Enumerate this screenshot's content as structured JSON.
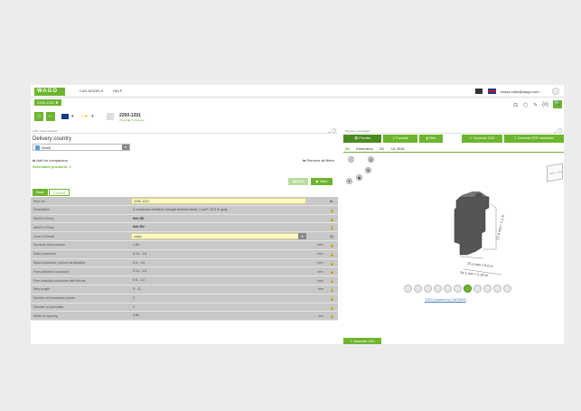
{
  "brand": {
    "logo": "WAGO",
    "accent": "#6cb52d"
  },
  "topnav": {
    "cad_models": "CAD MODELS",
    "help": "HELP",
    "user_email": "louisa.zahn@wago.com"
  },
  "open_tab": "2250-1201 ✖",
  "toolbar_icons": [
    "compare-icon",
    "cube-icon",
    "pencil-icon",
    "code-icon",
    "search-icon"
  ],
  "product": {
    "number": "2250-1201",
    "path": "WAGO ▶ Turbogene"
  },
  "left_panel": {
    "header": "CAD model selection",
    "delivery_country_title": "Delivery country",
    "country": "World",
    "add_comparison": "Add for comparison",
    "remove_filters": "Remove all filters",
    "selectable_products": "Selectable products: 1",
    "back": "◀ Back",
    "next": "▶ Next",
    "tabs": [
      "Base",
      "CLASS"
    ]
  },
  "attributes": [
    {
      "label": "Item No.",
      "value": "2250-1201",
      "style": "yellow",
      "dropdown": false,
      "unit": "",
      "lock": "⇆"
    },
    {
      "label": "Description",
      "value": "2-conductor miniature through terminal block; 1 mm²; 13.5 A; gray",
      "style": "",
      "dropdown": false,
      "unit": "",
      "lock": "🔒"
    },
    {
      "label": "WAGO eShop",
      "value": "Info DE",
      "style": "bold",
      "dropdown": false,
      "unit": "",
      "lock": "🔒"
    },
    {
      "label": "WAGO eShop",
      "value": "Info EN",
      "style": "bold",
      "dropdown": false,
      "unit": "",
      "lock": "🔒"
    },
    {
      "label": "Level of Detail",
      "value": "mdpe",
      "style": "yellow",
      "dropdown": true,
      "unit": "",
      "lock": "▤"
    },
    {
      "label": "Nominal cross section",
      "value": "1.00",
      "style": "",
      "dropdown": false,
      "unit": "mm²",
      "lock": "🔒"
    },
    {
      "label": "Solid conductor",
      "value": "0.14 - 1.5",
      "style": "",
      "dropdown": false,
      "unit": "mm²",
      "lock": "🔒"
    },
    {
      "label": "Solid conductor; push-in termination",
      "value": "0.5 - 1.5",
      "style": "",
      "dropdown": false,
      "unit": "mm²",
      "lock": "🔒"
    },
    {
      "label": "Fine-stranded conductor",
      "value": "0.14 - 1.5",
      "style": "",
      "dropdown": false,
      "unit": "mm²",
      "lock": "🔒"
    },
    {
      "label": "Fine-stranded conductor with ferrule",
      "value": "0.5 - 1.5",
      "style": "",
      "dropdown": false,
      "unit": "mm²",
      "lock": "🔒"
    },
    {
      "label": "Strip length",
      "value": "9 - 11",
      "style": "",
      "dropdown": false,
      "unit": "mm",
      "lock": "🔒"
    },
    {
      "label": "Number of connection points",
      "value": "2",
      "style": "",
      "dropdown": false,
      "unit": "",
      "lock": "🔒"
    },
    {
      "label": "Number of potentials",
      "value": "1",
      "style": "",
      "dropdown": false,
      "unit": "",
      "lock": "🔒"
    },
    {
      "label": "Width of spacing",
      "value": "3.50",
      "style": "",
      "dropdown": false,
      "unit": "mm",
      "lock": "🔒"
    }
  ],
  "right_panel": {
    "header": "Preview / Generation",
    "buttons": [
      "Preview",
      "Formats",
      "Files",
      "Generate CAD",
      "Generate PDF datasheet"
    ],
    "view_tabs": [
      "3D",
      "Dimension",
      "2D",
      "UL-EDA"
    ],
    "cube_labels": [
      "FRONT",
      "RIGHT"
    ],
    "dimensions": [
      "27.9 mm / 1.1 in",
      "15.4 mm / 0.6 in",
      "34.1 mm / 1.34 in"
    ],
    "powered_by": "©2023 powered by CADENAS",
    "generate_cad": "Generate CAD"
  }
}
